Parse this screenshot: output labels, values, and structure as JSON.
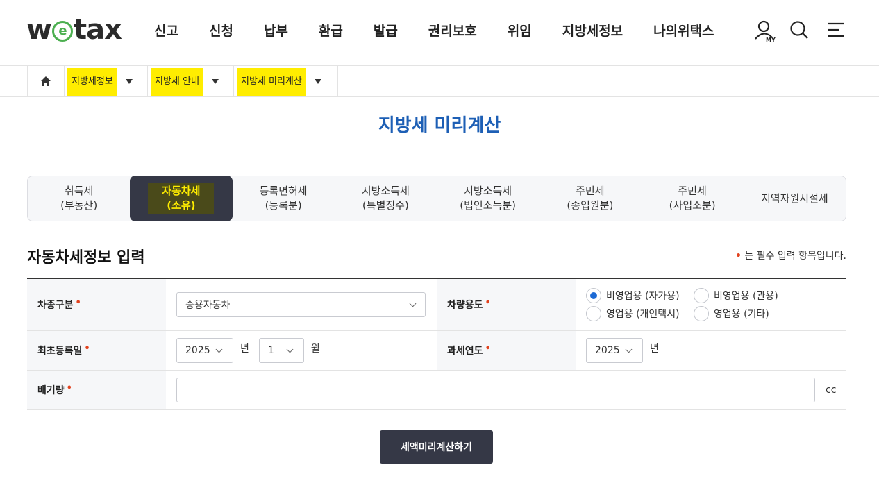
{
  "header": {
    "logo": {
      "pre": "w",
      "e": "e",
      "post": "tax"
    },
    "nav": [
      "신고",
      "신청",
      "납부",
      "환급",
      "발급",
      "권리보호",
      "위임",
      "지방세정보",
      "나의위택스"
    ],
    "my_label": "MY"
  },
  "breadcrumb": {
    "items": [
      {
        "label": "지방세정보"
      },
      {
        "label": "지방세 안내"
      },
      {
        "label": "지방세 미리계산"
      }
    ]
  },
  "page_title": "지방세 미리계산",
  "tabs": [
    {
      "line1": "취득세",
      "line2": "(부동산)",
      "active": false
    },
    {
      "line1": "자동차세",
      "line2": "(소유)",
      "active": true
    },
    {
      "line1": "등록면허세",
      "line2": "(등록분)",
      "active": false
    },
    {
      "line1": "지방소득세",
      "line2": "(특별징수)",
      "active": false
    },
    {
      "line1": "지방소득세",
      "line2": "(법인소득분)",
      "active": false
    },
    {
      "line1": "주민세",
      "line2": "(종업원분)",
      "active": false
    },
    {
      "line1": "주민세",
      "line2": "(사업소분)",
      "active": false
    },
    {
      "line1": "지역자원시설세",
      "line2": "",
      "active": false
    }
  ],
  "section": {
    "title": "자동차세정보 입력",
    "required_note": "는 필수 입력 항목입니다.",
    "required_mark": "•"
  },
  "form": {
    "vehicle_type": {
      "label": "차종구분",
      "value": "승용자동차"
    },
    "vehicle_use": {
      "label": "차량용도",
      "options": [
        {
          "label": "비영업용 (자가용)",
          "checked": true
        },
        {
          "label": "비영업용 (관용)",
          "checked": false
        },
        {
          "label": "영업용 (개인택시)",
          "checked": false
        },
        {
          "label": "영업용 (기타)",
          "checked": false
        }
      ]
    },
    "first_registration": {
      "label": "최초등록일",
      "year": "2025",
      "year_unit": "년",
      "month": "1",
      "month_unit": "월"
    },
    "tax_year": {
      "label": "과세연도",
      "year": "2025",
      "year_unit": "년"
    },
    "displacement": {
      "label": "배기량",
      "value": "",
      "unit": "cc"
    }
  },
  "calc_button": "세액미리계산하기",
  "colors": {
    "accent_blue": "#1d5fb5",
    "highlight": "#ffed00",
    "dark": "#353846",
    "required": "#e2431f",
    "logo_green": "#4caf50"
  }
}
